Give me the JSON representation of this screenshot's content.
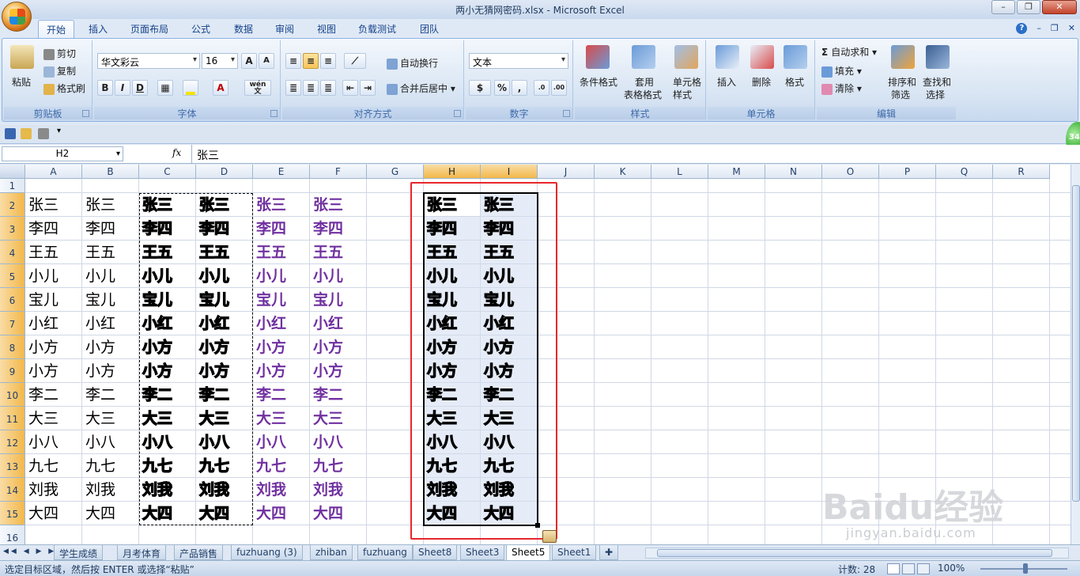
{
  "window": {
    "title": "两小无猜网密码.xlsx - Microsoft Excel"
  },
  "ribbon_tabs": [
    "开始",
    "插入",
    "页面布局",
    "公式",
    "数据",
    "审阅",
    "视图",
    "负载测试",
    "团队"
  ],
  "clipboard": {
    "paste": "粘贴",
    "cut": "剪切",
    "copy": "复制",
    "format_painter": "格式刷",
    "label": "剪贴板"
  },
  "font": {
    "name": "华文彩云",
    "size": "16",
    "label": "字体",
    "bold": "B",
    "italic": "I",
    "underline": "D",
    "grow": "A",
    "shrink": "A",
    "wen": "wén",
    "wen_char": "文"
  },
  "alignment": {
    "wrap": "自动换行",
    "merge": "合并后居中",
    "label": "对齐方式"
  },
  "number": {
    "format": "文本",
    "percent": "%",
    "comma": ",",
    "label": "数字"
  },
  "styles": {
    "conditional": "条件格式",
    "table1": "套用",
    "table2": "表格格式",
    "cell1": "单元格",
    "cell2": "样式",
    "label": "样式"
  },
  "cells": {
    "insert": "插入",
    "delete": "删除",
    "format": "格式",
    "label": "单元格"
  },
  "editing": {
    "autosum": "自动求和",
    "fill": "填充",
    "clear": "清除",
    "sort1": "排序和",
    "sort2": "筛选",
    "find1": "查找和",
    "find2": "选择",
    "label": "编辑"
  },
  "formula_bar": {
    "name_box": "H2",
    "fx": "fx",
    "content": "张三"
  },
  "columns": [
    "A",
    "B",
    "C",
    "D",
    "E",
    "F",
    "G",
    "H",
    "I",
    "J",
    "K",
    "L",
    "M",
    "N",
    "O",
    "P",
    "Q",
    "R"
  ],
  "rows": [
    "1",
    "2",
    "3",
    "4",
    "5",
    "6",
    "7",
    "8",
    "9",
    "10",
    "11",
    "12",
    "13",
    "14",
    "15",
    "16"
  ],
  "names": [
    "张三",
    "李四",
    "王五",
    "小儿",
    "宝儿",
    "小红",
    "小方",
    "小方",
    "李二",
    "大三",
    "小八",
    "九七",
    "刘我",
    "大四"
  ],
  "sheet_tabs": [
    "学生成绩",
    "月考体育",
    "产品销售",
    "fuzhuang (3)",
    "zhiban",
    "fuzhuang",
    "Sheet8",
    "Sheet3",
    "Sheet5",
    "Sheet1"
  ],
  "active_sheet": "Sheet5",
  "status": {
    "message": "选定目标区域，然后按 ENTER 或选择“粘贴”",
    "count": "计数: 28",
    "zoom": "100%"
  },
  "badge": "34",
  "watermark": {
    "logo": "Baidu经验",
    "url": "jingyan.baidu.com"
  }
}
